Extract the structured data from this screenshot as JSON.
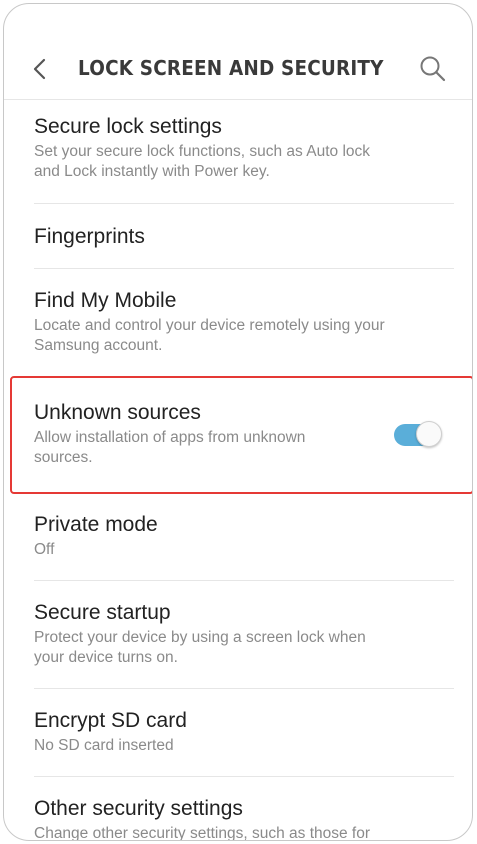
{
  "header": {
    "back_icon": "chevron-left-icon",
    "title": "LOCK SCREEN AND SECURITY",
    "search_icon": "search-icon"
  },
  "items": [
    {
      "label": "Secure lock settings",
      "desc": "Set your secure lock functions, such as Auto lock\nand Lock instantly with Power key."
    },
    {
      "label": "Fingerprints",
      "desc": ""
    },
    {
      "label": "Find My Mobile",
      "desc": "Locate and control your device remotely using your\nSamsung account."
    },
    {
      "label": "Unknown sources",
      "desc": "Allow installation of apps from unknown\nsources.",
      "toggle": true
    },
    {
      "label": "Private mode",
      "desc": "Off"
    },
    {
      "label": "Secure startup",
      "desc": "Protect your device by using a screen lock when\nyour device turns on."
    },
    {
      "label": "Encrypt SD card",
      "desc": "No SD card inserted"
    },
    {
      "label": "Other security settings",
      "desc": "Change other security settings, such as those for"
    }
  ],
  "colors": {
    "toggle_on": "#5aaed9",
    "highlight": "#e53935"
  }
}
